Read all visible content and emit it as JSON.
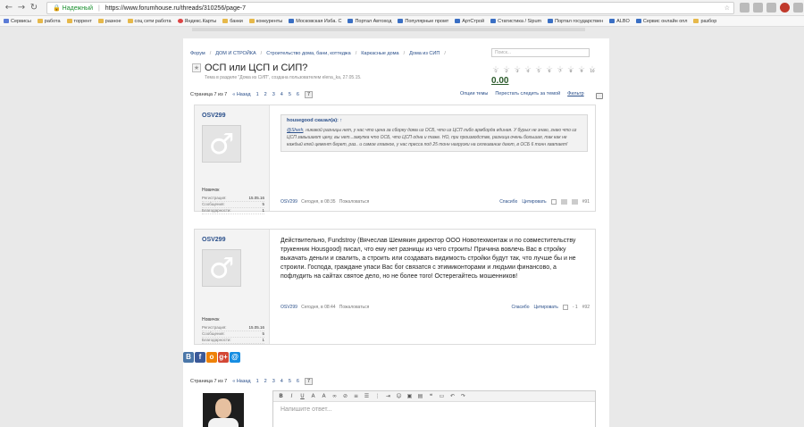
{
  "browser": {
    "secure_label": "Надежный",
    "url": "https://www.forumhouse.ru/threads/310256/page-7"
  },
  "bookmarks": [
    {
      "label": "Сервисы",
      "icon": "apps-icon"
    },
    {
      "label": "работа",
      "icon": "folder-icon"
    },
    {
      "label": "торрент",
      "icon": "folder-icon"
    },
    {
      "label": "разное",
      "icon": "folder-icon"
    },
    {
      "label": "соц сети работа",
      "icon": "folder-icon"
    },
    {
      "label": "Яндекс.Карты",
      "icon": "map-pin-icon"
    },
    {
      "label": "банки",
      "icon": "folder-icon"
    },
    {
      "label": "конкуренты",
      "icon": "folder-icon"
    },
    {
      "label": "Московская Изба. С",
      "icon": "site-icon"
    },
    {
      "label": "Портал Автоход",
      "icon": "site-icon"
    },
    {
      "label": "Популярные промт",
      "icon": "site-icon"
    },
    {
      "label": "АртСтрой",
      "icon": "site-icon"
    },
    {
      "label": "Статистика / Sipum",
      "icon": "site-icon"
    },
    {
      "label": "Портал государствен",
      "icon": "site-icon"
    },
    {
      "label": "ALBO",
      "icon": "site-icon"
    },
    {
      "label": "Сервис онлайн опл",
      "icon": "site-icon"
    },
    {
      "label": "разбор",
      "icon": "folder-icon"
    }
  ],
  "breadcrumbs": [
    "Форум",
    "ДОМ И СТРОЙКА",
    "Строительство дома, бани, коттеджа",
    "Каркасные дома",
    "Дома из СИП"
  ],
  "search_placeholder": "Поиск...",
  "thread": {
    "title": "ОСП или ЦСП и СИП?",
    "meta": "Тема в разделе \"Дома из СИП\", создана пользователем elena_ka, 27.05.15."
  },
  "rating": {
    "stars": [
      "1",
      "2",
      "3",
      "4",
      "5",
      "6",
      "7",
      "8",
      "9",
      "10"
    ],
    "value": "0.00"
  },
  "pager": {
    "label": "Страница 7 из 7",
    "back": "« Назад",
    "pages": [
      "1",
      "2",
      "3",
      "4",
      "5",
      "6"
    ],
    "current": "7"
  },
  "thread_tools": [
    "Опции темы",
    "Перестать следить за темой",
    "Фильтр"
  ],
  "posts": [
    {
      "author": "OSV299",
      "user_title": "Новичок",
      "stats": [
        {
          "label": "Регистрация:",
          "value": "15.05.16"
        },
        {
          "label": "Сообщения:",
          "value": "5"
        },
        {
          "label": "Благодарности:",
          "value": "1"
        }
      ],
      "quote_head": "housegood сказал(а):",
      "quote_mention": "@Sherh",
      "quote_text": ", никакой разницы нет, у нас что цена за сборку дома из ОСБ, что из ЦСП либо армборда единая. У бурых не знаю, знаю что из ЦСП завышают цену, вы нет...закупка что ОСБ, что ЦСП одна и таже. НО, при производстве, разница очень большая, так как не каждый клей цемент берет, раз.. и самое главное, у нас пресса под 25 тонн нагрузки на склеивание дают, в ОСБ 6 тонн хватает!",
      "text": "",
      "foot_author": "OSV299",
      "foot_time": "Сегодня, в 08:35",
      "report": "Пожаловаться",
      "thanks": "Спасибо",
      "quote_btn": "Цитировать",
      "num": "#91"
    },
    {
      "author": "OSV299",
      "user_title": "Новичок",
      "stats": [
        {
          "label": "Регистрация:",
          "value": "15.05.16"
        },
        {
          "label": "Сообщения:",
          "value": "5"
        },
        {
          "label": "Благодарности:",
          "value": "1"
        }
      ],
      "quote_head": "",
      "quote_mention": "",
      "quote_text": "",
      "text": "Действительно, Fundstroy (Вячеслав Шемякин директор ООО Новотехмонтаж и по совместительству трукенник Housgood) писал, что ему нет разницы из чего строить! Причина вовлечь Вас в стройку выкачать деньги и свалить, а строить или создавать видимость стройки будут так, что лучше бы и не строили. Господа, граждане упаси Вас бог связатся с этимиконторами и людьми финансово, а пофлудить на сайтах святое дело, но не более того! Остерегайтесь мошенников!",
      "foot_author": "OSV299",
      "foot_time": "Сегодня, в 08:44",
      "report": "Пожаловаться",
      "thanks": "Спасибо",
      "quote_btn": "Цитировать",
      "score": "- 1",
      "num": "#92"
    }
  ],
  "reply": {
    "placeholder": "Напишите ответ..."
  },
  "share": [
    "В",
    "f",
    "о",
    "g+",
    "@"
  ],
  "colors": {
    "link": "#2a4f8a",
    "accent_green": "#1a8f2e"
  }
}
